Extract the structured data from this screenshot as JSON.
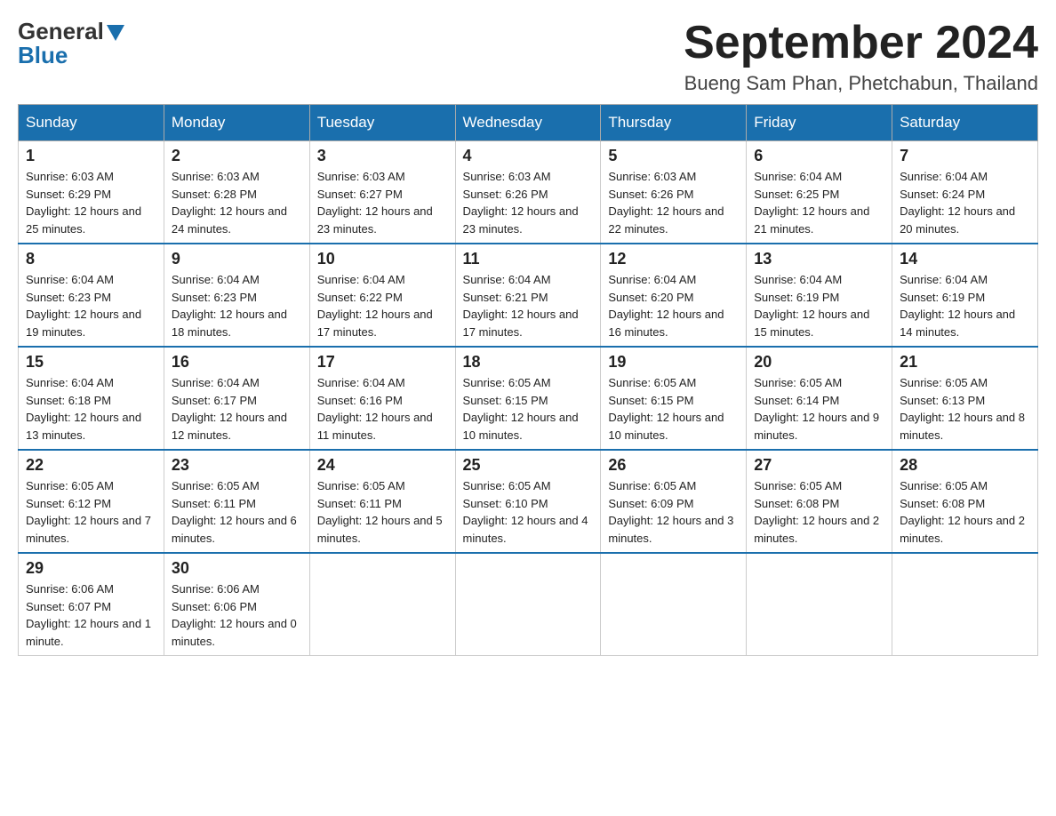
{
  "header": {
    "logo_general": "General",
    "logo_blue": "Blue",
    "month_title": "September 2024",
    "location": "Bueng Sam Phan, Phetchabun, Thailand"
  },
  "days_of_week": [
    "Sunday",
    "Monday",
    "Tuesday",
    "Wednesday",
    "Thursday",
    "Friday",
    "Saturday"
  ],
  "weeks": [
    [
      {
        "day": "1",
        "sunrise": "6:03 AM",
        "sunset": "6:29 PM",
        "daylight": "12 hours and 25 minutes."
      },
      {
        "day": "2",
        "sunrise": "6:03 AM",
        "sunset": "6:28 PM",
        "daylight": "12 hours and 24 minutes."
      },
      {
        "day": "3",
        "sunrise": "6:03 AM",
        "sunset": "6:27 PM",
        "daylight": "12 hours and 23 minutes."
      },
      {
        "day": "4",
        "sunrise": "6:03 AM",
        "sunset": "6:26 PM",
        "daylight": "12 hours and 23 minutes."
      },
      {
        "day": "5",
        "sunrise": "6:03 AM",
        "sunset": "6:26 PM",
        "daylight": "12 hours and 22 minutes."
      },
      {
        "day": "6",
        "sunrise": "6:04 AM",
        "sunset": "6:25 PM",
        "daylight": "12 hours and 21 minutes."
      },
      {
        "day": "7",
        "sunrise": "6:04 AM",
        "sunset": "6:24 PM",
        "daylight": "12 hours and 20 minutes."
      }
    ],
    [
      {
        "day": "8",
        "sunrise": "6:04 AM",
        "sunset": "6:23 PM",
        "daylight": "12 hours and 19 minutes."
      },
      {
        "day": "9",
        "sunrise": "6:04 AM",
        "sunset": "6:23 PM",
        "daylight": "12 hours and 18 minutes."
      },
      {
        "day": "10",
        "sunrise": "6:04 AM",
        "sunset": "6:22 PM",
        "daylight": "12 hours and 17 minutes."
      },
      {
        "day": "11",
        "sunrise": "6:04 AM",
        "sunset": "6:21 PM",
        "daylight": "12 hours and 17 minutes."
      },
      {
        "day": "12",
        "sunrise": "6:04 AM",
        "sunset": "6:20 PM",
        "daylight": "12 hours and 16 minutes."
      },
      {
        "day": "13",
        "sunrise": "6:04 AM",
        "sunset": "6:19 PM",
        "daylight": "12 hours and 15 minutes."
      },
      {
        "day": "14",
        "sunrise": "6:04 AM",
        "sunset": "6:19 PM",
        "daylight": "12 hours and 14 minutes."
      }
    ],
    [
      {
        "day": "15",
        "sunrise": "6:04 AM",
        "sunset": "6:18 PM",
        "daylight": "12 hours and 13 minutes."
      },
      {
        "day": "16",
        "sunrise": "6:04 AM",
        "sunset": "6:17 PM",
        "daylight": "12 hours and 12 minutes."
      },
      {
        "day": "17",
        "sunrise": "6:04 AM",
        "sunset": "6:16 PM",
        "daylight": "12 hours and 11 minutes."
      },
      {
        "day": "18",
        "sunrise": "6:05 AM",
        "sunset": "6:15 PM",
        "daylight": "12 hours and 10 minutes."
      },
      {
        "day": "19",
        "sunrise": "6:05 AM",
        "sunset": "6:15 PM",
        "daylight": "12 hours and 10 minutes."
      },
      {
        "day": "20",
        "sunrise": "6:05 AM",
        "sunset": "6:14 PM",
        "daylight": "12 hours and 9 minutes."
      },
      {
        "day": "21",
        "sunrise": "6:05 AM",
        "sunset": "6:13 PM",
        "daylight": "12 hours and 8 minutes."
      }
    ],
    [
      {
        "day": "22",
        "sunrise": "6:05 AM",
        "sunset": "6:12 PM",
        "daylight": "12 hours and 7 minutes."
      },
      {
        "day": "23",
        "sunrise": "6:05 AM",
        "sunset": "6:11 PM",
        "daylight": "12 hours and 6 minutes."
      },
      {
        "day": "24",
        "sunrise": "6:05 AM",
        "sunset": "6:11 PM",
        "daylight": "12 hours and 5 minutes."
      },
      {
        "day": "25",
        "sunrise": "6:05 AM",
        "sunset": "6:10 PM",
        "daylight": "12 hours and 4 minutes."
      },
      {
        "day": "26",
        "sunrise": "6:05 AM",
        "sunset": "6:09 PM",
        "daylight": "12 hours and 3 minutes."
      },
      {
        "day": "27",
        "sunrise": "6:05 AM",
        "sunset": "6:08 PM",
        "daylight": "12 hours and 2 minutes."
      },
      {
        "day": "28",
        "sunrise": "6:05 AM",
        "sunset": "6:08 PM",
        "daylight": "12 hours and 2 minutes."
      }
    ],
    [
      {
        "day": "29",
        "sunrise": "6:06 AM",
        "sunset": "6:07 PM",
        "daylight": "12 hours and 1 minute."
      },
      {
        "day": "30",
        "sunrise": "6:06 AM",
        "sunset": "6:06 PM",
        "daylight": "12 hours and 0 minutes."
      },
      null,
      null,
      null,
      null,
      null
    ]
  ]
}
